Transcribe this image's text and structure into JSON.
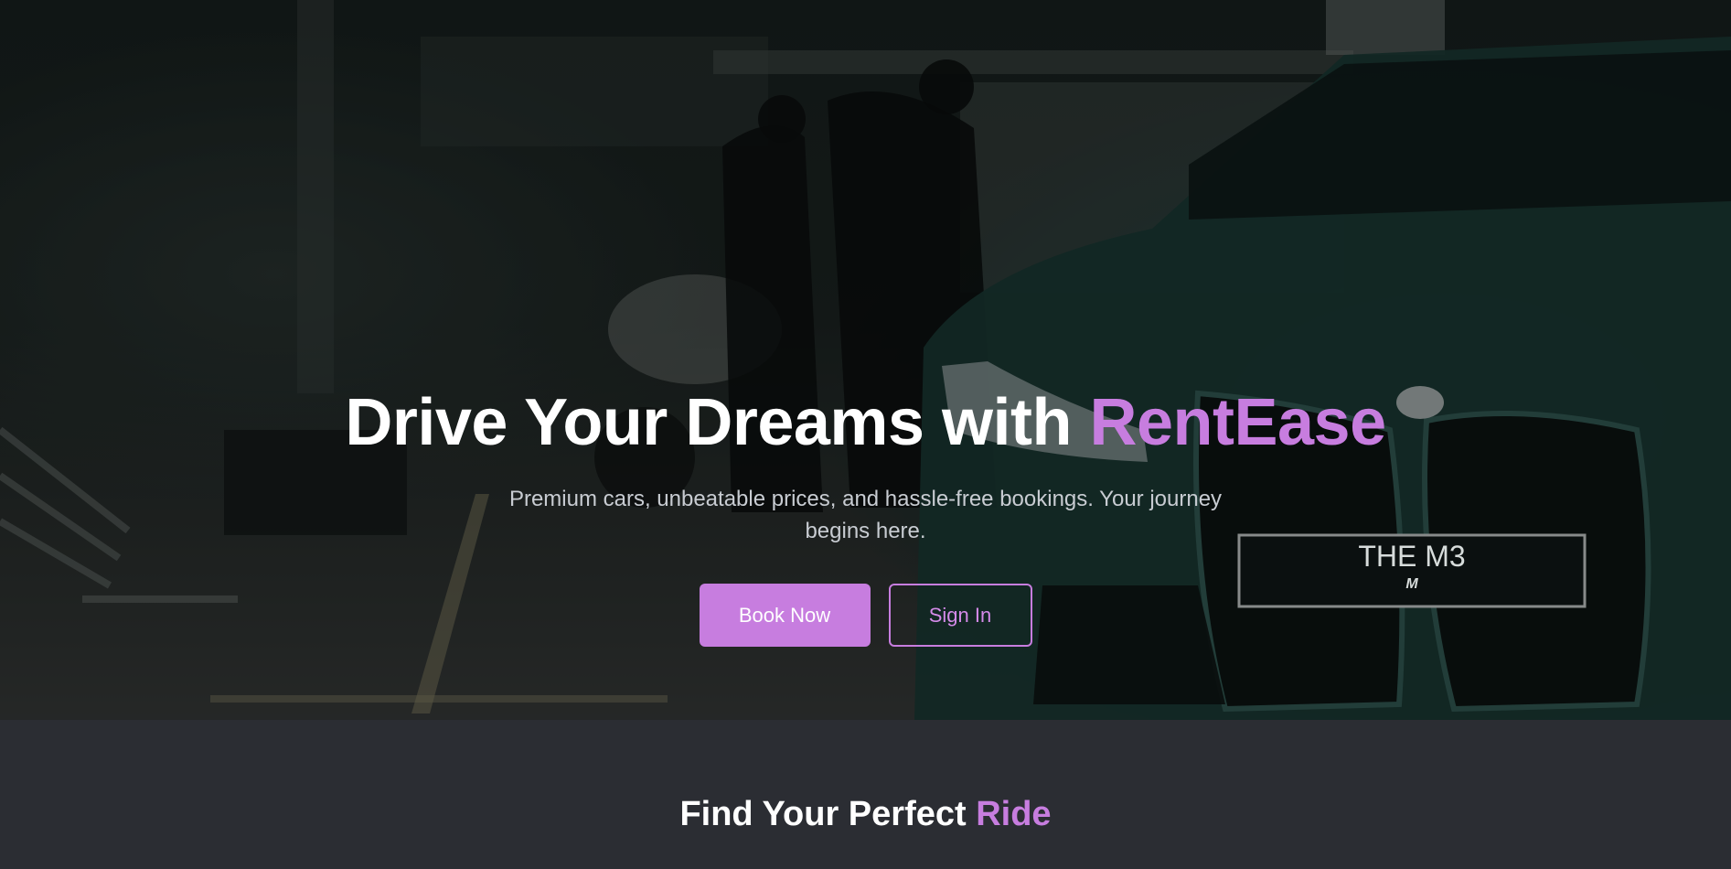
{
  "hero": {
    "title_main": "Drive Your Dreams with ",
    "title_accent": "RentEase",
    "subtitle": "Premium cars, unbeatable prices, and hassle-free bookings. Your journey begins here.",
    "book_button": "Book Now",
    "signin_button": "Sign In",
    "plate_text": "THE M3",
    "plate_badge": "M"
  },
  "section": {
    "title_main": "Find Your Perfect ",
    "title_accent": "Ride"
  },
  "colors": {
    "accent": "#c77ddf",
    "section_bg": "#2b2d33"
  }
}
